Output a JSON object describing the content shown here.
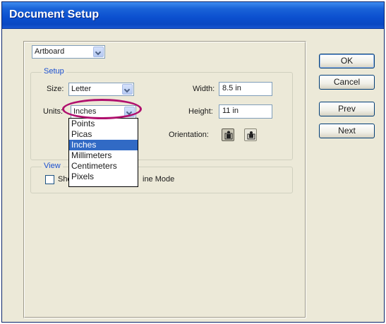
{
  "window": {
    "title": "Document Setup"
  },
  "panel_selector": {
    "value": "Artboard"
  },
  "setup": {
    "legend": "Setup",
    "size_label": "Size:",
    "size_value": "Letter",
    "units_label": "Units:",
    "units_value": "Inches",
    "width_label": "Width:",
    "width_value": "8.5 in",
    "height_label": "Height:",
    "height_value": "11 in",
    "orientation_label": "Orientation:",
    "orientation": {
      "portrait_icon": "portrait-orientation-icon",
      "landscape_icon": "landscape-orientation-icon",
      "selected": "portrait"
    }
  },
  "units_dropdown": {
    "options": [
      "Points",
      "Picas",
      "Inches",
      "Millimeters",
      "Centimeters",
      "Pixels"
    ],
    "selected_index": 2
  },
  "view": {
    "legend": "View",
    "checkbox_label_left": "Sho",
    "checkbox_label_right": "ine Mode"
  },
  "buttons": {
    "ok": "OK",
    "cancel": "Cancel",
    "prev": "Prev",
    "next": "Next"
  },
  "colors": {
    "title_bar": "#0b4fcf",
    "dialog_bg": "#ece9d8",
    "highlight_ring": "#b0106e",
    "selection": "#316ac5",
    "legend_text": "#1a4fd0"
  }
}
